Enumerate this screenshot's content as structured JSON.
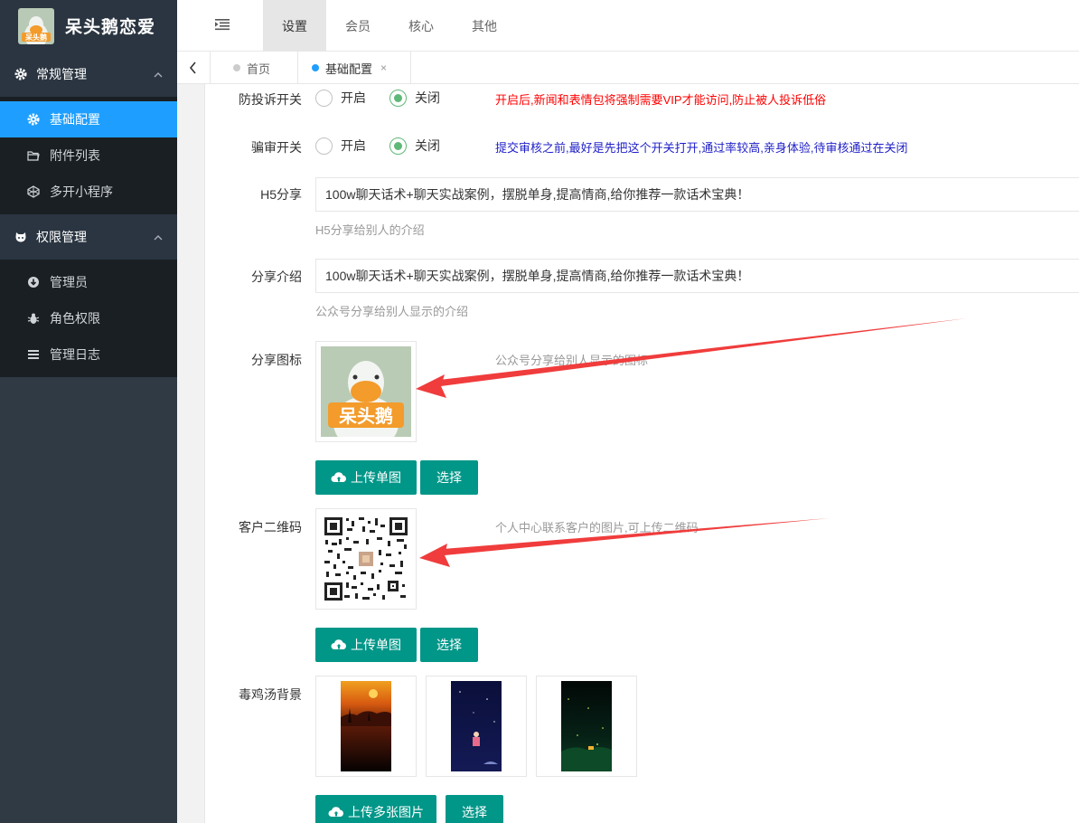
{
  "brand": {
    "title": "呆头鹅恋爱",
    "logo_text": "呆头鹅"
  },
  "sidebar": {
    "groups": [
      {
        "label": "常规管理",
        "icon": "gear-icon",
        "items": [
          {
            "label": "基础配置",
            "icon": "gear-icon",
            "active": true
          },
          {
            "label": "附件列表",
            "icon": "folder-icon"
          },
          {
            "label": "多开小程序",
            "icon": "codepen-icon"
          }
        ]
      },
      {
        "label": "权限管理",
        "icon": "github-icon",
        "items": [
          {
            "label": "管理员",
            "icon": "download-circle-icon"
          },
          {
            "label": "角色权限",
            "icon": "bug-icon"
          },
          {
            "label": "管理日志",
            "icon": "list-icon"
          }
        ]
      }
    ]
  },
  "header": {
    "nav": [
      "设置",
      "会员",
      "核心",
      "其他"
    ],
    "active_nav": "设置"
  },
  "tabs": {
    "home": "首页",
    "current": "基础配置",
    "close": "×"
  },
  "form": {
    "complaint": {
      "label": "防投诉开关",
      "on": "开启",
      "off": "关闭",
      "note": "开启后,新闻和表情包将强制需要VIP才能访问,防止被人投诉低俗",
      "note_color": "#ff0000"
    },
    "review": {
      "label": "骗审开关",
      "on": "开启",
      "off": "关闭",
      "note": "提交审核之前,最好是先把这个开关打开,通过率较高,亲身体验,待审核通过在关闭",
      "note_color": "#1e1ec8"
    },
    "h5share": {
      "label": "H5分享",
      "value": "100w聊天话术+聊天实战案例，摆脱单身,提高情商,给你推荐一款话术宝典！",
      "help": "H5分享给别人的介绍"
    },
    "share_intro": {
      "label": "分享介绍",
      "value": "100w聊天话术+聊天实战案例，摆脱单身,提高情商,给你推荐一款话术宝典！",
      "help": "公众号分享给别人显示的介绍"
    },
    "share_icon": {
      "label": "分享图标",
      "hint": "公众号分享给别人显示的图标",
      "upload": "上传单图",
      "select": "选择",
      "image_text": "呆头鹅"
    },
    "qrcode": {
      "label": "客户二维码",
      "hint": "个人中心联系客户的图片,可上传二维码",
      "upload": "上传单图",
      "select": "选择"
    },
    "bg": {
      "label": "毒鸡汤背景",
      "upload": "上传多张图片",
      "select": "选择"
    }
  },
  "colors": {
    "accent": "#009688",
    "sidebar": "#2f3a45",
    "active": "#1e9fff",
    "arrow": "#f03c3c"
  }
}
